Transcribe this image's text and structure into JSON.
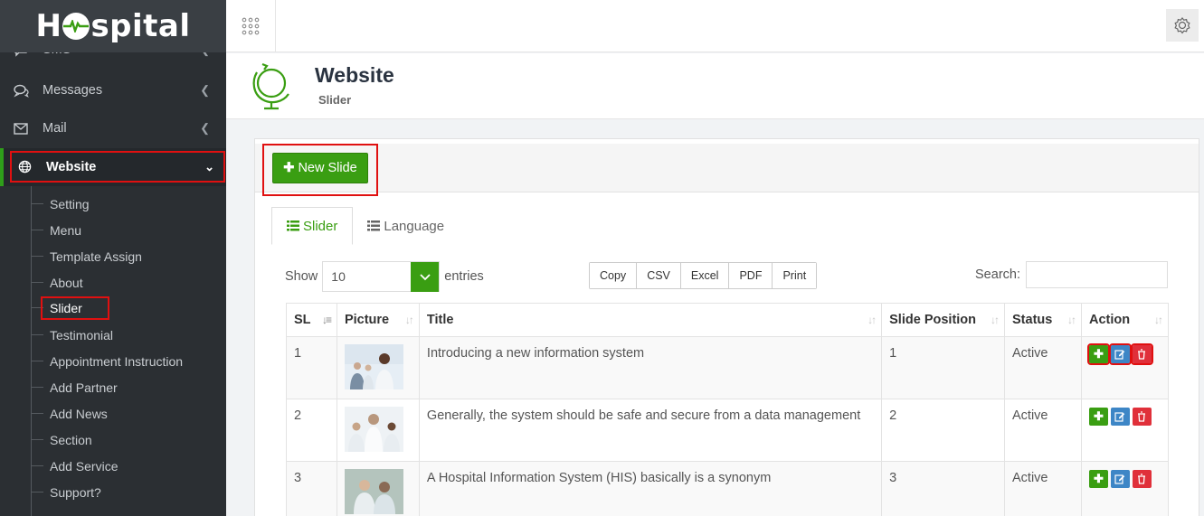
{
  "app": {
    "logo_text_before": "H",
    "logo_text_after": "spital"
  },
  "colors": {
    "accent_green": "#3a9e12",
    "sidebar_bg": "#2b2f33",
    "highlight_red": "#e01010",
    "edit_blue": "#3d86c6",
    "delete_red": "#e0303a"
  },
  "sidebar": {
    "partial_item": {
      "label": "SMS",
      "icon": "chat-icon"
    },
    "items": [
      {
        "label": "Messages",
        "icon": "comments-icon"
      },
      {
        "label": "Mail",
        "icon": "envelope-icon"
      }
    ],
    "active": {
      "label": "Website",
      "icon": "globe-icon"
    },
    "submenu": [
      {
        "label": "Setting"
      },
      {
        "label": "Menu"
      },
      {
        "label": "Template Assign"
      },
      {
        "label": "About"
      },
      {
        "label": "Slider"
      },
      {
        "label": "Testimonial"
      },
      {
        "label": "Appointment Instruction"
      },
      {
        "label": "Add Partner"
      },
      {
        "label": "Add News"
      },
      {
        "label": "Section"
      },
      {
        "label": "Add Service"
      },
      {
        "label": "Support?"
      }
    ]
  },
  "topbar": {
    "apps_icon": "grid-icon",
    "settings_icon": "gear-icon"
  },
  "page_header": {
    "title": "Website",
    "subtitle": "Slider",
    "icon": "globe-stand-icon"
  },
  "panel": {
    "new_button": "New Slide",
    "tabs": [
      {
        "label": "Slider",
        "active": true
      },
      {
        "label": "Language",
        "active": false
      }
    ],
    "show_label": "Show",
    "entries_value": "10",
    "entries_label": "entries",
    "export_buttons": [
      "Copy",
      "CSV",
      "Excel",
      "PDF",
      "Print"
    ],
    "search_label": "Search:",
    "search_value": ""
  },
  "table": {
    "columns": [
      "SL",
      "Picture",
      "Title",
      "Slide Position",
      "Status",
      "Action"
    ],
    "rows": [
      {
        "sl": "1",
        "title": "Introducing a new information system",
        "position": "1",
        "status": "Active"
      },
      {
        "sl": "2",
        "title": "Generally, the system should be safe and secure from a data management",
        "position": "2",
        "status": "Active"
      },
      {
        "sl": "3",
        "title": "A Hospital Information System (HIS) basically is a synonym",
        "position": "3",
        "status": "Active"
      }
    ]
  }
}
